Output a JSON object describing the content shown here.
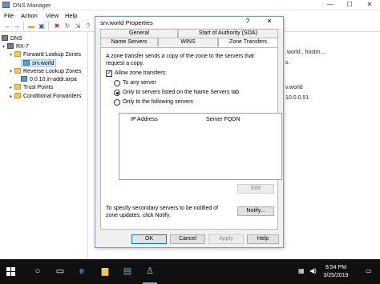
{
  "window": {
    "title": "DNS Manager",
    "controls": {
      "minimize": "—",
      "maximize": "☐",
      "close": "✕"
    }
  },
  "menu": [
    "File",
    "Action",
    "View",
    "Help"
  ],
  "toolbar_icons": [
    "back-icon",
    "forward-icon",
    "folder-icon",
    "properties-icon",
    "refresh-icon",
    "delete-icon",
    "export-icon",
    "help-icon"
  ],
  "tree": {
    "items": [
      {
        "label": "DNS",
        "icon": "dns-icon",
        "arrow": ""
      },
      {
        "label": "RX-7",
        "icon": "server-icon",
        "arrow": "▾"
      },
      {
        "label": "Forward Lookup Zones",
        "icon": "folder-icon",
        "arrow": "▾"
      },
      {
        "label": "srv.world",
        "icon": "zone-icon",
        "arrow": ""
      },
      {
        "label": "Reverse Lookup Zones",
        "icon": "folder-icon",
        "arrow": "▾"
      },
      {
        "label": "0.0.10.in-addr.arpa",
        "icon": "zone-icon",
        "arrow": ""
      },
      {
        "label": "Trust Points",
        "icon": "folder-icon",
        "arrow": "▸"
      },
      {
        "label": "Conditional Forwarders",
        "icon": "folder-icon",
        "arrow": "▸"
      }
    ]
  },
  "right_pane_partial": [
    ".world., hostm...",
    "s.",
    "v.world",
    "10.0.0.51"
  ],
  "dialog": {
    "title": "srv.world Properties",
    "help": "?",
    "close": "✕",
    "tabs_row1": [
      "General",
      "Start of Authority (SOA)"
    ],
    "tabs_row2": [
      "Name Servers",
      "WINS",
      "Zone Transfers"
    ],
    "active_tab": "Zone Transfers",
    "description": "A zone transfer sends a copy of the zone to the servers that request a copy.",
    "allow_checkbox": {
      "label": "Allow zone transfers:",
      "checked": true,
      "mark": "✓"
    },
    "radios": [
      {
        "label": "To any server",
        "selected": false
      },
      {
        "label": "Only to servers listed on the Name Servers tab",
        "selected": true
      },
      {
        "label": "Only to the following servers",
        "selected": false
      }
    ],
    "table_headers": [
      "IP Address",
      "Server FQDN"
    ],
    "edit_button": "Edit",
    "notify_description": "To specify secondary servers to be notified of zone updates, click Notify.",
    "notify_button": "Notify...",
    "buttons": [
      "OK",
      "Cancel",
      "Apply",
      "Help"
    ]
  },
  "taskbar": {
    "icons": [
      "start-icon",
      "search-icon",
      "task-view-icon",
      "edge-icon",
      "file-explorer-icon",
      "server-manager-icon",
      "dns-manager-icon"
    ],
    "tray": [
      "network-icon",
      "volume-icon"
    ],
    "time": "8:54 PM",
    "date": "3/25/2019"
  }
}
